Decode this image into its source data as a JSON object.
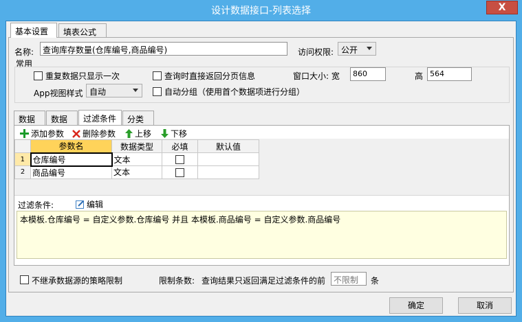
{
  "window": {
    "title": "设计数据接口-列表选择",
    "close_glyph": "X"
  },
  "top_tabs": [
    {
      "label": "基本设置"
    },
    {
      "label": "填表公式"
    }
  ],
  "basic": {
    "name_label": "名称:",
    "name_value": "查询库存数量(仓库编号,商品编号)",
    "access_label": "访问权限:",
    "access_value": "公开"
  },
  "common": {
    "group_label": "常用",
    "show_once": "重复数据只显示一次",
    "direct_page": "查询时直接返回分页信息",
    "window_size_label": "窗口大小: 宽",
    "width_value": "860",
    "height_label": "高",
    "height_value": "564",
    "app_view_label": "App视图样式",
    "app_view_value": "自动",
    "auto_group": "自动分组（使用首个数据项进行分组）"
  },
  "inner_tabs": [
    {
      "label": "数据源"
    },
    {
      "label": "数据列"
    },
    {
      "label": "过滤条件"
    },
    {
      "label": "分类树"
    }
  ],
  "toolbar": {
    "add": "添加参数",
    "delete": "删除参数",
    "up": "上移",
    "down": "下移"
  },
  "grid": {
    "headers": [
      "参数名",
      "数据类型",
      "必填",
      "默认值"
    ],
    "rows": [
      {
        "num": "1",
        "name": "仓库编号",
        "type": "文本",
        "required": false,
        "default": ""
      },
      {
        "num": "2",
        "name": "商品编号",
        "type": "文本",
        "required": false,
        "default": ""
      }
    ]
  },
  "filter": {
    "label": "过滤条件:",
    "edit_label": "编辑",
    "expression": "本模板.仓库编号 = 自定义参数.仓库编号 并且 本模板.商品编号 = 自定义参数.商品编号"
  },
  "bottom": {
    "inherit_label": "不继承数据源的策略限制",
    "limit_label": "限制条数:",
    "limit_desc": "查询结果只返回满足过滤条件的前",
    "limit_placeholder": "不限制",
    "limit_unit": "条"
  },
  "buttons": {
    "ok": "确定",
    "cancel": "取消"
  },
  "colors": {
    "title_bar": "#52aee8",
    "close": "#c74f42",
    "header_selected": "#ffd35a",
    "filter_bg": "#ffffe1"
  }
}
